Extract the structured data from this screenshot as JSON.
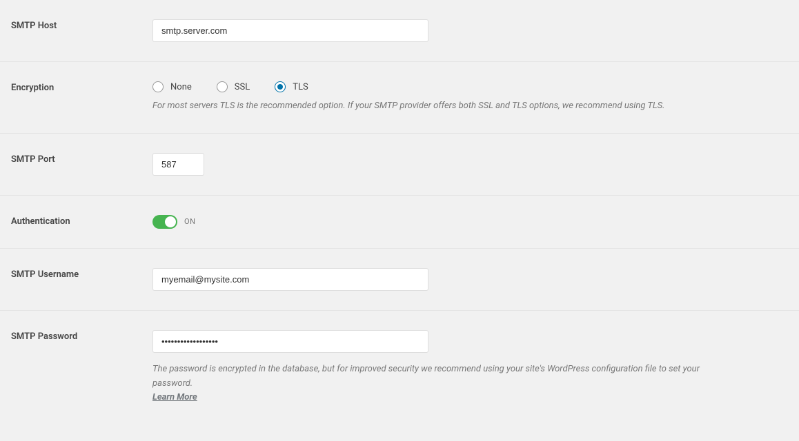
{
  "smtp_host": {
    "label": "SMTP Host",
    "value": "smtp.server.com"
  },
  "encryption": {
    "label": "Encryption",
    "options": {
      "none": "None",
      "ssl": "SSL",
      "tls": "TLS"
    },
    "selected": "tls",
    "description": "For most servers TLS is the recommended option. If your SMTP provider offers both SSL and TLS options, we recommend using TLS."
  },
  "smtp_port": {
    "label": "SMTP Port",
    "value": "587"
  },
  "authentication": {
    "label": "Authentication",
    "state_label": "ON"
  },
  "smtp_username": {
    "label": "SMTP Username",
    "value": "myemail@mysite.com"
  },
  "smtp_password": {
    "label": "SMTP Password",
    "value": "••••••••••••••••••",
    "description": "The password is encrypted in the database, but for improved security we recommend using your site's WordPress configuration file to set your password.",
    "learn_more": "Learn More"
  }
}
